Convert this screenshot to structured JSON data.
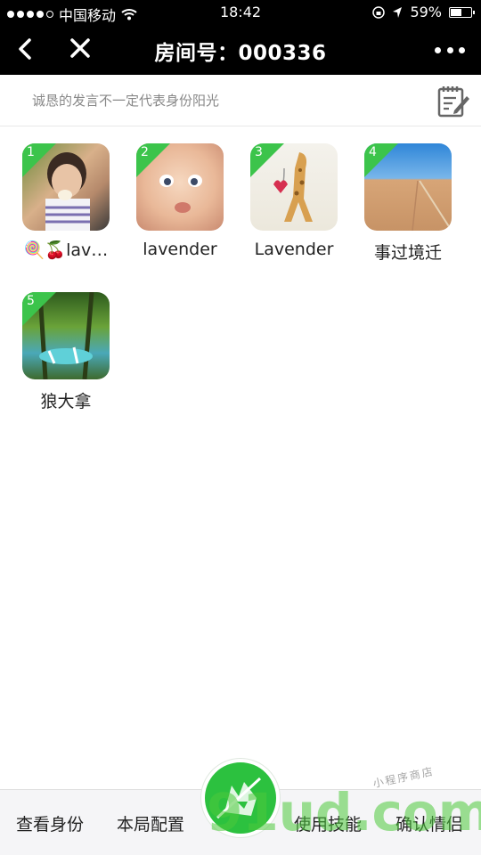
{
  "status_bar": {
    "carrier": "中国移动",
    "time": "18:42",
    "battery": "59%",
    "battery_level": 0.59
  },
  "nav": {
    "title": "房间号：000336",
    "back_icon": "chevron-left-icon",
    "close_icon": "close-icon",
    "more_icon": "more-dots-icon"
  },
  "notice": {
    "text": "诚恳的发言不一定代表身份阳光",
    "edit_icon": "edit-note-icon"
  },
  "players": [
    {
      "seat": "1",
      "name": "🍭🍒lav…"
    },
    {
      "seat": "2",
      "name": "lavender"
    },
    {
      "seat": "3",
      "name": "Lavender"
    },
    {
      "seat": "4",
      "name": "事过境迁"
    },
    {
      "seat": "5",
      "name": "狼大拿"
    }
  ],
  "bottom_bar": {
    "tabs": [
      "查看身份",
      "本局配置",
      "使用技能",
      "确认情侣"
    ],
    "center_icon": "wolf-logo-icon"
  },
  "watermark": {
    "main": "91ud.com",
    "sub": "小程序商店"
  },
  "colors": {
    "accent_green": "#3cc44b",
    "nav_bg": "#000000"
  }
}
